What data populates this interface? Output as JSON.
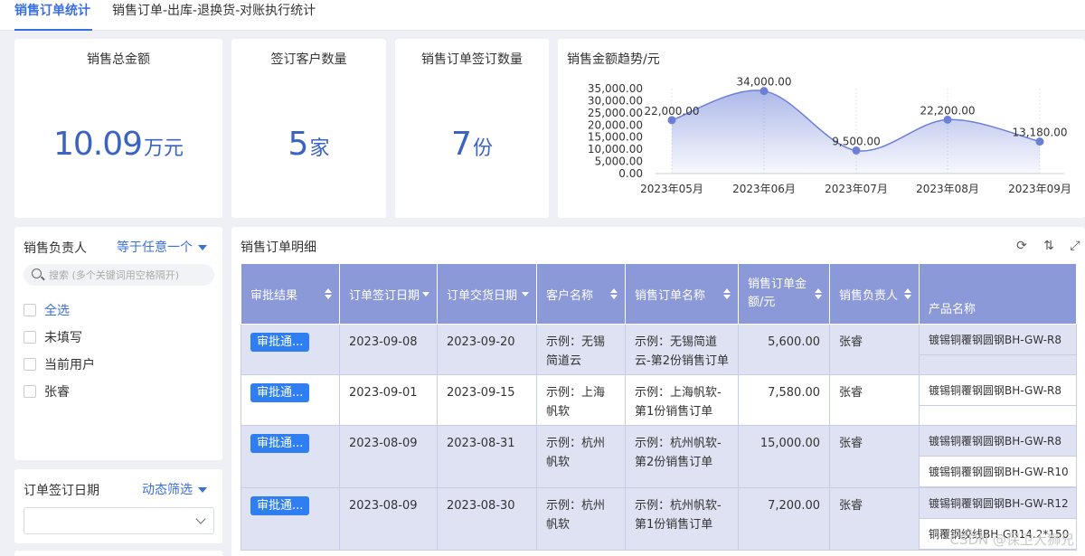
{
  "tabs": [
    {
      "label": "销售订单统计",
      "active": true
    },
    {
      "label": "销售订单-出库-退换货-对账执行统计",
      "active": false
    }
  ],
  "kpis": {
    "total_amount": {
      "title": "销售总金额",
      "value": "10.09",
      "unit": "万元"
    },
    "customer_count": {
      "title": "签订客户数量",
      "value": "5",
      "unit": "家"
    },
    "order_count": {
      "title": "销售订单签订数量",
      "value": "7",
      "unit": "份"
    }
  },
  "chart_data": {
    "type": "area",
    "title": "销售金额趋势/元",
    "categories": [
      "2023年05月",
      "2023年06月",
      "2023年07月",
      "2023年08月",
      "2023年09月"
    ],
    "values": [
      22000,
      34000,
      9500,
      22200,
      13180
    ],
    "value_labels": [
      "22,000.00",
      "34,000.00",
      "9,500.00",
      "22,200.00",
      "13,180.00"
    ],
    "y_ticks": [
      "0.00",
      "5,000.00",
      "10,000.00",
      "15,000.00",
      "20,000.00",
      "25,000.00",
      "30,000.00",
      "35,000.00"
    ],
    "ylim": [
      0,
      35000
    ],
    "color": "#6b7fd7"
  },
  "filters": {
    "owner": {
      "label": "销售负责人",
      "mode": "等于任意一个",
      "search_placeholder": "搜索 (多个关键词用空格隔开)",
      "options": [
        "全选",
        "未填写",
        "当前用户",
        "张睿"
      ]
    },
    "sign_date": {
      "label": "订单签订日期",
      "mode": "动态筛选"
    }
  },
  "table": {
    "title": "销售订单明细",
    "columns": [
      "审批结果",
      "订单签订日期",
      "订单交货日期",
      "客户名称",
      "销售订单名称",
      "销售订单金额/元",
      "销售负责人",
      "产品名称"
    ],
    "rows": [
      {
        "status": "审批通...",
        "sign_date": "2023-09-08",
        "delivery_date": "2023-09-20",
        "customer": "示例：无锡简道云",
        "order_name": "示例：无锡简道云-第2份销售订单",
        "amount": "5,600.00",
        "owner": "张睿",
        "products": [
          "镀锡铜覆钢圆钢BH-GW-R8"
        ]
      },
      {
        "status": "审批通...",
        "sign_date": "2023-09-01",
        "delivery_date": "2023-09-15",
        "customer": "示例：上海帆软",
        "order_name": "示例：上海帆软-第1份销售订单",
        "amount": "7,580.00",
        "owner": "张睿",
        "products": [
          "镀锡铜覆钢圆钢BH-GW-R8"
        ]
      },
      {
        "status": "审批通...",
        "sign_date": "2023-08-09",
        "delivery_date": "2023-08-31",
        "customer": "示例：杭州帆软",
        "order_name": "示例：杭州帆软-第2份销售订单",
        "amount": "15,000.00",
        "owner": "张睿",
        "products": [
          "镀锡铜覆钢圆钢BH-GW-R8",
          "镀锡铜覆钢圆钢BH-GW-R10"
        ]
      },
      {
        "status": "审批通...",
        "sign_date": "2023-08-09",
        "delivery_date": "2023-08-30",
        "customer": "示例：杭州帆软",
        "order_name": "示例：杭州帆软-第1份销售订单",
        "amount": "7,200.00",
        "owner": "张睿",
        "products": [
          "镀锡铜覆钢圆钢BH-GW-R12",
          "铜覆钢绞线BH-GR14.2*150"
        ]
      }
    ]
  },
  "watermark": "CSDN @保卫大狮兄"
}
